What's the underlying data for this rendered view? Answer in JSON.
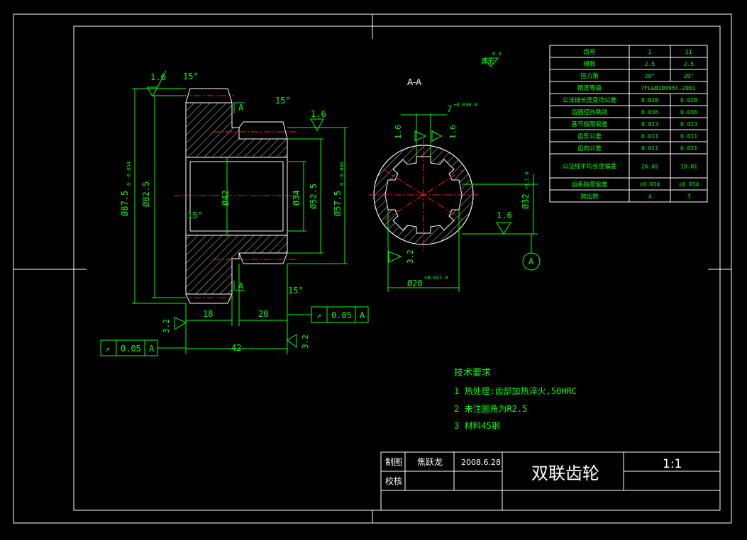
{
  "view_label": "A-A",
  "section_mark": "A",
  "datum_label": "A",
  "roughness_other": "其余",
  "roughness_values": {
    "r16": "1.6",
    "r32": "3.2",
    "r63": "6.3"
  },
  "angles": {
    "a15": "15°"
  },
  "dims": {
    "d87": "Ø87.5",
    "d87_tol": "0 -0.054",
    "d82": "Ø82.5",
    "d42": "Ø42",
    "d34": "Ø34",
    "d52": "Ø52.5",
    "d57": "Ø57.5",
    "d57_tol": "0 -0.046",
    "l18": "18",
    "l20": "20",
    "l42": "42",
    "key7": "7",
    "key7_tol": "+0.036 0",
    "key32": "Ø32",
    "key32_tol": "+0.1 0",
    "key28": "Ø28",
    "key28_tol": "+0.021 0"
  },
  "tolerance_frames": [
    {
      "symbol": "↗",
      "value": "0.05",
      "datum": "A"
    },
    {
      "symbol": "↗",
      "value": "0.05",
      "datum": "A"
    }
  ],
  "gear_table": {
    "header": [
      "齿号",
      "I",
      "II"
    ],
    "rows": [
      [
        "模数",
        "2.5",
        "2.5"
      ],
      [
        "压力角",
        "20°",
        "20°"
      ],
      [
        "精度等级",
        "7FLGB10095l-2001",
        ""
      ],
      [
        "公法线长度变动公差",
        "0.028",
        "0.028"
      ],
      [
        "齿圈径向跳动",
        "0.036",
        "0.036"
      ],
      [
        "基节极限偏差",
        "0.013",
        "0.013"
      ],
      [
        "齿形公差",
        "0.011",
        "0.011"
      ],
      [
        "齿向公差",
        "0.011",
        "0.011"
      ],
      [
        "公法线平均长度偏差",
        "26.65",
        "19.01"
      ],
      [
        "齿距极限偏差",
        "±0.014",
        "±0.014"
      ],
      [
        "跨齿数",
        "4",
        "3"
      ]
    ]
  },
  "tech_requirements": {
    "title": "技术要求",
    "items": [
      "1 热处理:齿部加热淬火,50HRC",
      "2 未注圆角为R2.5",
      "3 材料45钢"
    ]
  },
  "title_block": {
    "drawn_label": "制图",
    "drawn_by": "焦跃龙",
    "date": "2008.6.28",
    "check_label": "校核",
    "part_name": "双联齿轮",
    "scale": "1:1"
  }
}
